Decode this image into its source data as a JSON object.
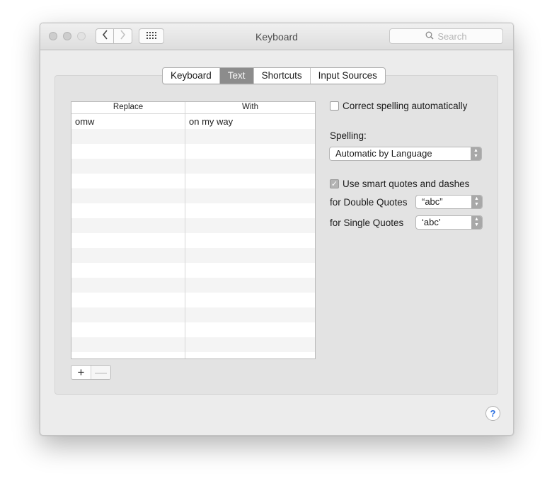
{
  "window": {
    "title": "Keyboard"
  },
  "search": {
    "placeholder": "Search"
  },
  "tabs": [
    {
      "label": "Keyboard",
      "selected": false
    },
    {
      "label": "Text",
      "selected": true
    },
    {
      "label": "Shortcuts",
      "selected": false
    },
    {
      "label": "Input Sources",
      "selected": false
    }
  ],
  "table": {
    "headers": {
      "replace": "Replace",
      "with": "With"
    },
    "rows": [
      {
        "replace": "omw",
        "with": "on my way"
      }
    ]
  },
  "controls": {
    "plus": "+",
    "minus": "—",
    "correct_spelling_label": "Correct spelling automatically",
    "correct_spelling_checked": false,
    "spelling_label": "Spelling:",
    "spelling_value": "Automatic by Language",
    "smart_quotes_label": "Use smart quotes and dashes",
    "smart_quotes_checked": true,
    "double_quotes_label": "for Double Quotes",
    "double_quotes_value": "“abc”",
    "single_quotes_label": "for Single Quotes",
    "single_quotes_value": "‘abc’",
    "help": "?"
  }
}
